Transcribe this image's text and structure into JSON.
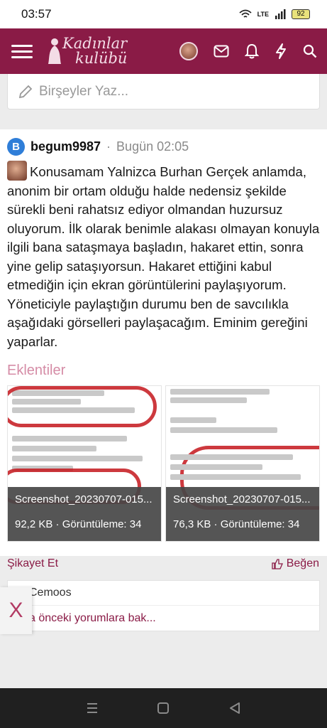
{
  "status": {
    "time": "03:57",
    "battery": "92",
    "network": "LTE"
  },
  "appbar": {
    "logo_line1": "Kadınlar",
    "logo_line2": "kulübü"
  },
  "composer": {
    "placeholder": "Birşeyler Yaz..."
  },
  "post": {
    "avatar_letter": "B",
    "username": "begum9987",
    "separator": "·",
    "time": "Bugün 02:05",
    "body": "Konusamam Yalnizca Burhan Gerçek anlamda, anonim bir ortam olduğu halde nedensiz şekilde sürekli beni rahatsız ediyor olmandan huzursuz oluyorum. İlk olarak benimle alakası olmayan konuyla ilgili bana sataşmaya başladın, hakaret ettin, sonra yine gelip sataşıyorsun. Hakaret ettiğini kabul etmediğin için ekran görüntülerini paylaşıyorum. Yöneticiyle paylaştığın durumu ben de savcılıkla aşağıdaki görselleri paylaşacağım. Eminim gereğini yaparlar.",
    "attachments_title": "Eklentiler",
    "attachments": [
      {
        "name": "Screenshot_20230707-015...",
        "size": "92,2 KB",
        "views": "Görüntüleme: 34"
      },
      {
        "name": "Screenshot_20230707-015...",
        "size": "76,3 KB",
        "views": "Görüntüleme: 34"
      }
    ],
    "report_label": "Şikayet Et",
    "like_label": "Beğen"
  },
  "comments": {
    "first_author": "Cemoos",
    "load_more": "a önceki yorumlara bak..."
  },
  "overlay": {
    "close_label": "X"
  }
}
